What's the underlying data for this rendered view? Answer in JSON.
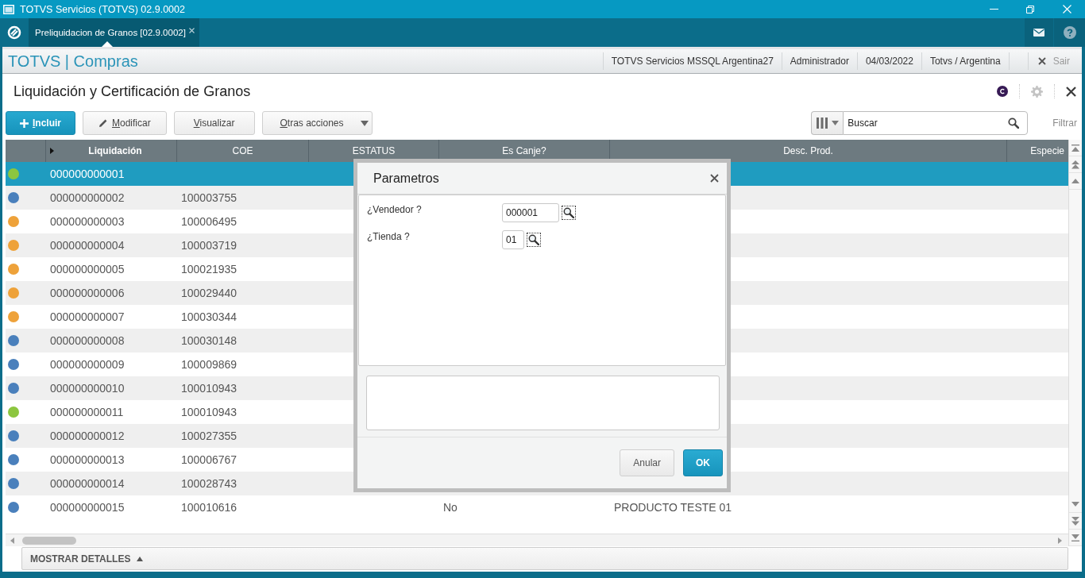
{
  "window": {
    "title": "TOTVS Servicios (TOTVS) 02.9.0002"
  },
  "tabs": [
    {
      "label": "Preliquidacion de Granos [02.9.0002]",
      "selected": true
    }
  ],
  "app_bar": {
    "brand": "TOTVS | Compras",
    "info": [
      "TOTVS Servicios MSSQL Argentina27",
      "Administrador",
      "04/03/2022",
      "Totvs / Argentina"
    ],
    "exit": "Sair"
  },
  "page": {
    "title": "Liquidación y Certificación de Granos"
  },
  "toolbar": {
    "buttons": [
      {
        "label": "Incluir",
        "kind": "primary"
      },
      {
        "label": "Modificar",
        "kind": "edit"
      },
      {
        "label": "Visualizar",
        "kind": "plain"
      },
      {
        "label": "Otras acciones",
        "kind": "menu"
      }
    ],
    "search": {
      "placeholder": "Buscar"
    },
    "filter": "Filtrar"
  },
  "table": {
    "columns": [
      {
        "label": "Liquidación",
        "sorted": true
      },
      {
        "label": "COE",
        "sorted": false
      },
      {
        "label": "ESTATUS",
        "sorted": false
      },
      {
        "label": "Es Canje?",
        "sorted": false
      },
      {
        "label": "Desc. Prod.",
        "sorted": false
      },
      {
        "label": "Especie",
        "sorted": false
      }
    ],
    "rows": [
      {
        "color": "#8cc63f",
        "selected": true,
        "liquidacion": "000000000001"
      },
      {
        "color": "#4a80bc",
        "selected": false,
        "liquidacion": "000000000002",
        "coe": "100003755"
      },
      {
        "color": "#eea23a",
        "selected": false,
        "liquidacion": "000000000003",
        "coe": "100006495"
      },
      {
        "color": "#eea23a",
        "selected": false,
        "liquidacion": "000000000004",
        "coe": "100003719"
      },
      {
        "color": "#eea23a",
        "selected": false,
        "liquidacion": "000000000005",
        "coe": "100021935"
      },
      {
        "color": "#eea23a",
        "selected": false,
        "liquidacion": "000000000006",
        "coe": "100029440"
      },
      {
        "color": "#eea23a",
        "selected": false,
        "liquidacion": "000000000007",
        "coe": "100030344"
      },
      {
        "color": "#4a80bc",
        "selected": false,
        "liquidacion": "000000000008",
        "coe": "100030148"
      },
      {
        "color": "#4a80bc",
        "selected": false,
        "liquidacion": "000000000009",
        "coe": "100009869"
      },
      {
        "color": "#4a80bc",
        "selected": false,
        "liquidacion": "000000000010",
        "coe": "100010943"
      },
      {
        "color": "#8cc63f",
        "selected": false,
        "liquidacion": "000000000011",
        "coe": "100010943"
      },
      {
        "color": "#4a80bc",
        "selected": false,
        "liquidacion": "000000000012",
        "coe": "100027355"
      },
      {
        "color": "#4a80bc",
        "selected": false,
        "liquidacion": "000000000013",
        "coe": "100006767"
      },
      {
        "color": "#4a80bc",
        "selected": false,
        "liquidacion": "000000000014",
        "coe": "100028743"
      },
      {
        "color": "#4a80bc",
        "selected": false,
        "liquidacion": "000000000015",
        "coe": "100010616",
        "es_canje": "No",
        "desc_prod": "PRODUCTO TESTE 01"
      }
    ]
  },
  "details": {
    "label": "MOSTRAR DETALLES",
    "expanded": false
  },
  "dialog": {
    "title": "Parametros",
    "fields": [
      {
        "label": "¿Vendedor ?",
        "value": "000001"
      },
      {
        "label": "¿Tienda ?",
        "value": "01"
      }
    ],
    "buttons": [
      {
        "label": "Anular",
        "kind": "secondary"
      },
      {
        "label": "OK",
        "kind": "primary"
      }
    ]
  }
}
